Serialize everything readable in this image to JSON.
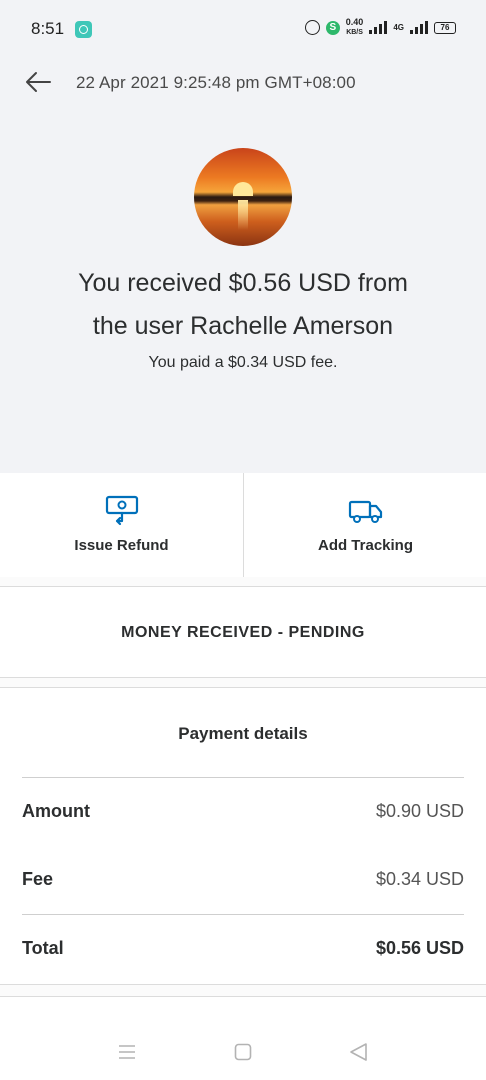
{
  "status_bar": {
    "time": "8:51",
    "net_speed_value": "0.40",
    "net_speed_unit": "KB/S",
    "network_type": "4G",
    "battery": "76"
  },
  "header": {
    "datetime": "22 Apr 2021 9:25:48 pm GMT+08:00"
  },
  "summary": {
    "headline_line1": "You received $0.56 USD from",
    "headline_line2": "the user Rachelle Amerson",
    "fee_note": "You paid a $0.34 USD fee."
  },
  "actions": [
    {
      "label": "Issue Refund",
      "icon": "refund-icon"
    },
    {
      "label": "Add Tracking",
      "icon": "truck-icon"
    }
  ],
  "transaction_status": "MONEY RECEIVED - PENDING",
  "payment_details": {
    "title": "Payment details",
    "rows": [
      {
        "label": "Amount",
        "value": "$0.90 USD"
      },
      {
        "label": "Fee",
        "value": "$0.34 USD"
      },
      {
        "label": "Total",
        "value": "$0.56 USD"
      }
    ]
  },
  "colors": {
    "accent": "#0070ba",
    "header_bg": "#f2f3f6",
    "text": "#2c2e2f"
  }
}
